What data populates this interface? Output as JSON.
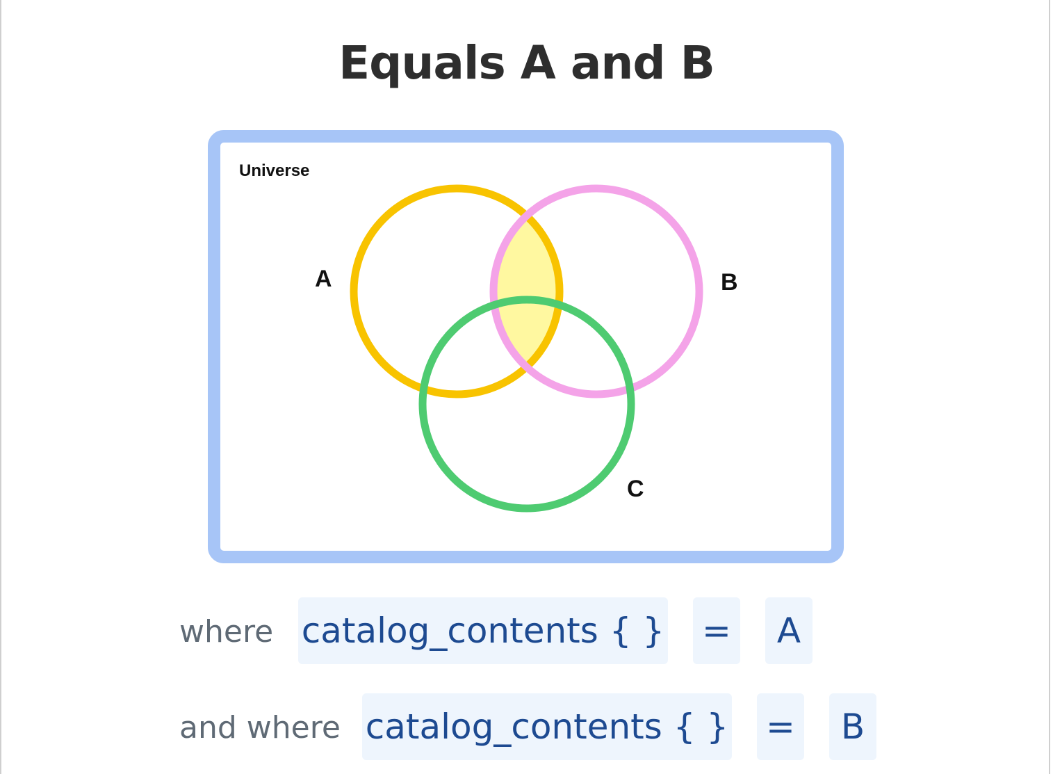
{
  "title": "Equals A and B",
  "diagram": {
    "universe_label": "Universe",
    "sets": [
      {
        "id": "A",
        "label": "A",
        "color": "#f8c300"
      },
      {
        "id": "B",
        "label": "B",
        "color": "#f4a3e8"
      },
      {
        "id": "C",
        "label": "C",
        "color": "#4ecb71"
      }
    ],
    "highlighted_region": "A ∩ B",
    "highlight_color": "#fff8a0",
    "universe_border_color": "#a7c5f7"
  },
  "clauses": [
    {
      "connector": "where",
      "field": "catalog_contents { }",
      "operator": "=",
      "value": "A"
    },
    {
      "connector": "and where",
      "field": "catalog_contents { }",
      "operator": "=",
      "value": "B"
    }
  ]
}
